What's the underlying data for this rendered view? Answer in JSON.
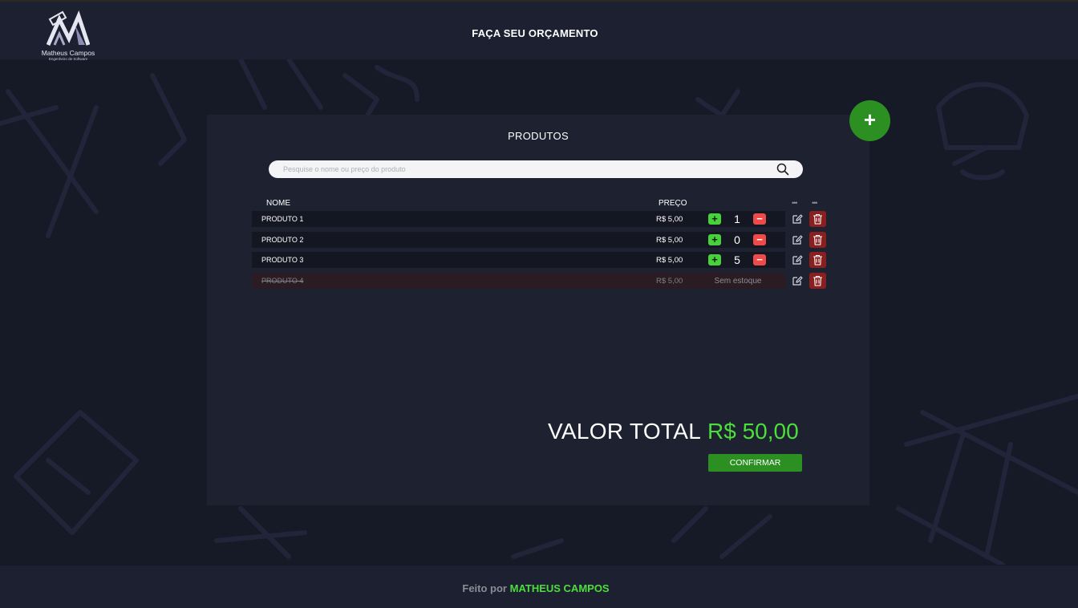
{
  "header": {
    "title": "FAÇA SEU ORÇAMENTO",
    "logo_name": "Matheus Campos",
    "logo_subtitle": "Engenheiro de Software"
  },
  "products": {
    "title": "PRODUTOS",
    "add_button": "+",
    "search": {
      "placeholder": "Pesquise o nome ou preço do produto",
      "icon": "search-icon"
    },
    "columns": {
      "name": "NOME",
      "price": "PREÇO",
      "edit": "•••",
      "delete": "•••"
    },
    "rows": [
      {
        "name": "PRODUTO 1",
        "price": "R$ 5,00",
        "quantity": "1",
        "in_stock": true
      },
      {
        "name": "PRODUTO 2",
        "price": "R$ 5,00",
        "quantity": "0",
        "in_stock": true
      },
      {
        "name": "PRODUTO 3",
        "price": "R$ 5,00",
        "quantity": "5",
        "in_stock": true
      },
      {
        "name": "PRODUTO 4",
        "price": "R$ 5,00",
        "stock_label": "Sem estoque",
        "in_stock": false
      }
    ],
    "plus_label": "+",
    "minus_label": "−"
  },
  "summary": {
    "total_label": "VALOR TOTAL",
    "total_value": "R$ 50,00",
    "confirm_label": "CONFIRMAR"
  },
  "footer": {
    "prefix": "Feito por",
    "author": "MATHEUS CAMPOS"
  },
  "colors": {
    "accent_green": "#2b8f22",
    "value_green": "#4cde3b",
    "danger_red": "#ef4a4a",
    "background": "#161a27",
    "panel": "#1d2130"
  }
}
